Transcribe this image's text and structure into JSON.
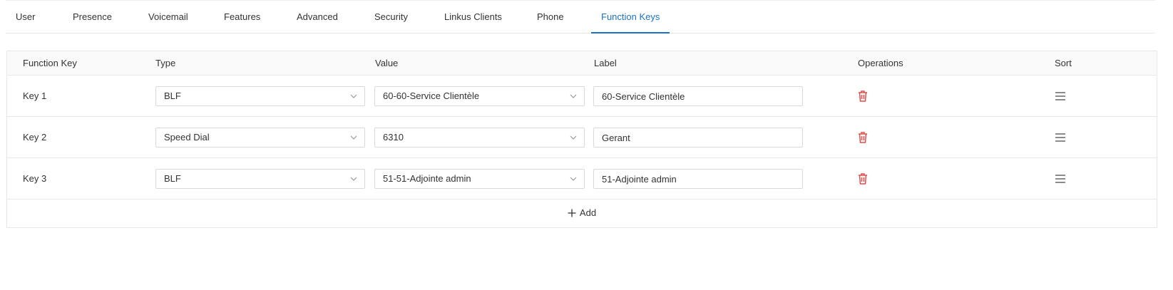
{
  "tabs": [
    {
      "label": "User",
      "active": false
    },
    {
      "label": "Presence",
      "active": false
    },
    {
      "label": "Voicemail",
      "active": false
    },
    {
      "label": "Features",
      "active": false
    },
    {
      "label": "Advanced",
      "active": false
    },
    {
      "label": "Security",
      "active": false
    },
    {
      "label": "Linkus Clients",
      "active": false
    },
    {
      "label": "Phone",
      "active": false
    },
    {
      "label": "Function Keys",
      "active": true
    }
  ],
  "table": {
    "headers": {
      "function_key": "Function Key",
      "type": "Type",
      "value": "Value",
      "label": "Label",
      "operations": "Operations",
      "sort": "Sort"
    },
    "rows": [
      {
        "key": "Key 1",
        "type": "BLF",
        "value": "60-60-Service Clientèle",
        "label": "60-Service Clientèle"
      },
      {
        "key": "Key 2",
        "type": "Speed Dial",
        "value": "6310",
        "label": "Gerant"
      },
      {
        "key": "Key 3",
        "type": "BLF",
        "value": "51-51-Adjointe admin",
        "label": "51-Adjointe admin"
      }
    ],
    "add_label": "Add"
  },
  "colors": {
    "accent": "#1a73c9",
    "delete": "#e84a4a",
    "border": "#e8e8e8",
    "header_bg": "#fafafa"
  },
  "icons": {
    "chevron": "chevron-down-icon",
    "delete": "trash-icon",
    "sort": "drag-handle-icon",
    "add": "plus-icon"
  }
}
